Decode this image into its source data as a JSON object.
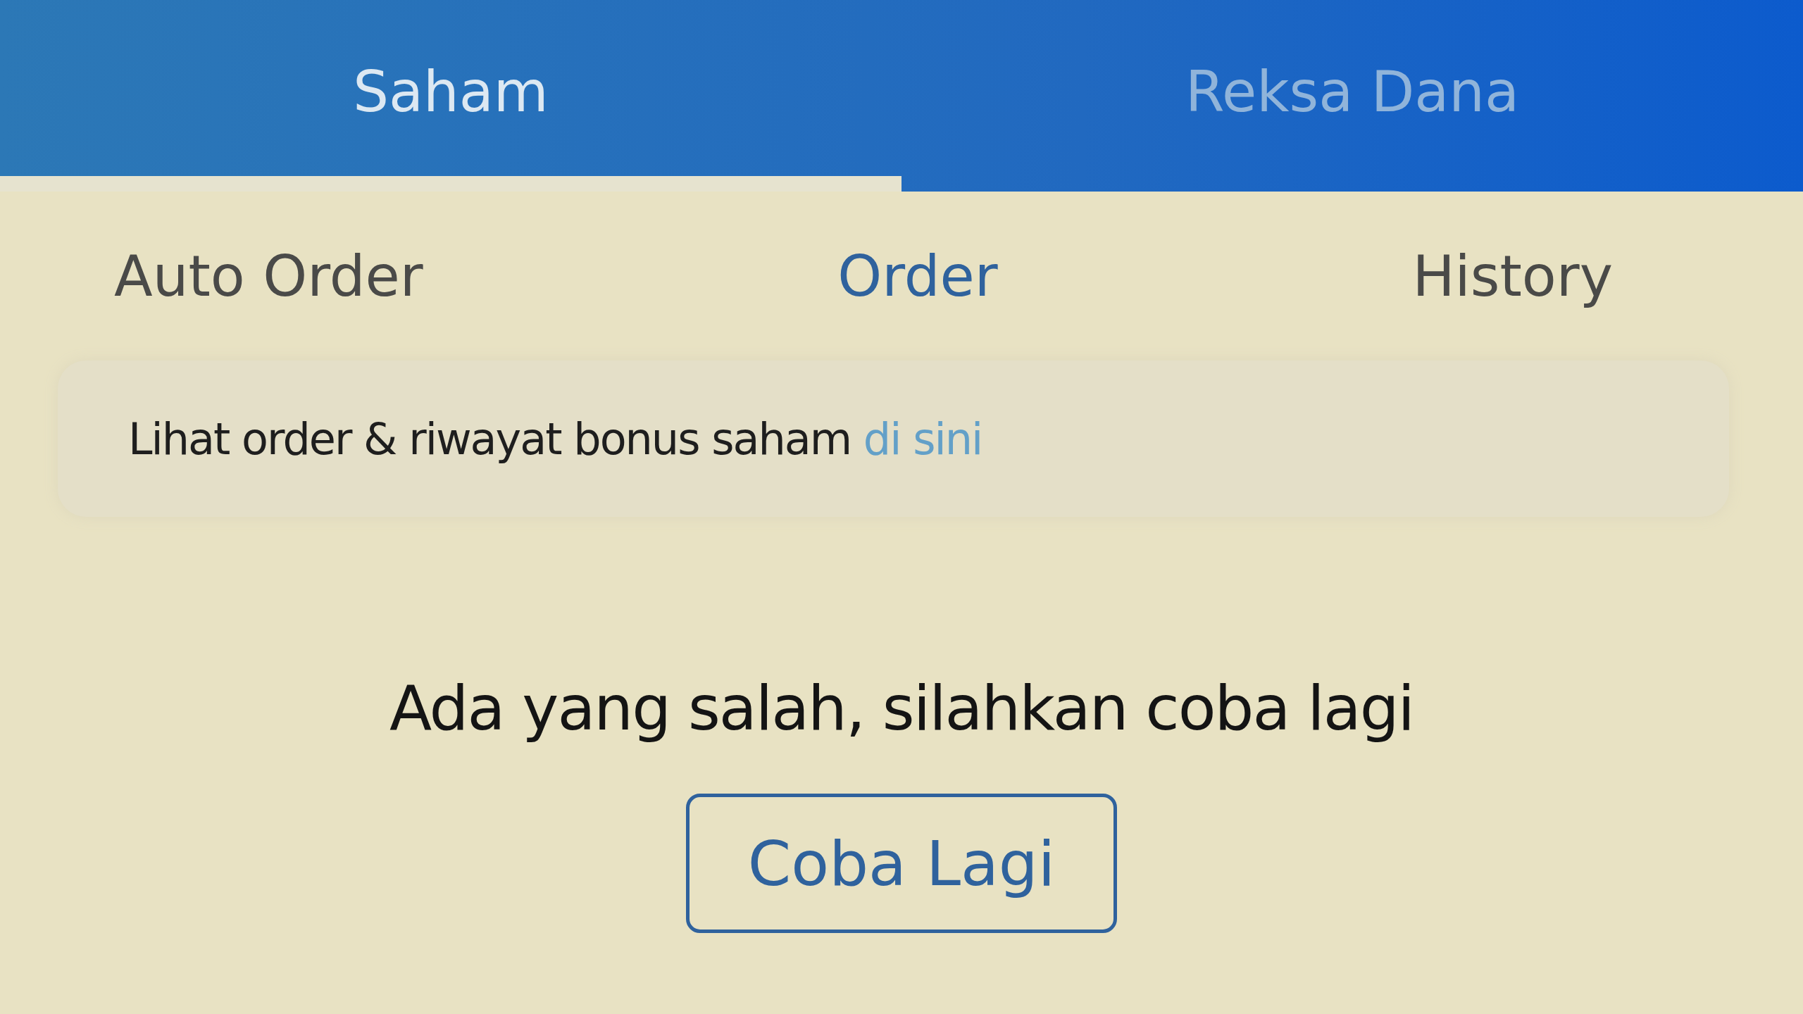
{
  "top_tabs": [
    {
      "label": "Saham",
      "selected": true
    },
    {
      "label": "Reksa Dana",
      "selected": false
    }
  ],
  "sub_tabs": [
    {
      "label": "Auto Order",
      "selected": false
    },
    {
      "label": "Order",
      "selected": true
    },
    {
      "label": "History",
      "selected": false
    }
  ],
  "info_banner": {
    "text": "Lihat order & riwayat bonus saham",
    "link": "di sini"
  },
  "error": {
    "message": "Ada yang salah, silahkan coba lagi"
  },
  "retry_button": {
    "label": "Coba Lagi"
  }
}
